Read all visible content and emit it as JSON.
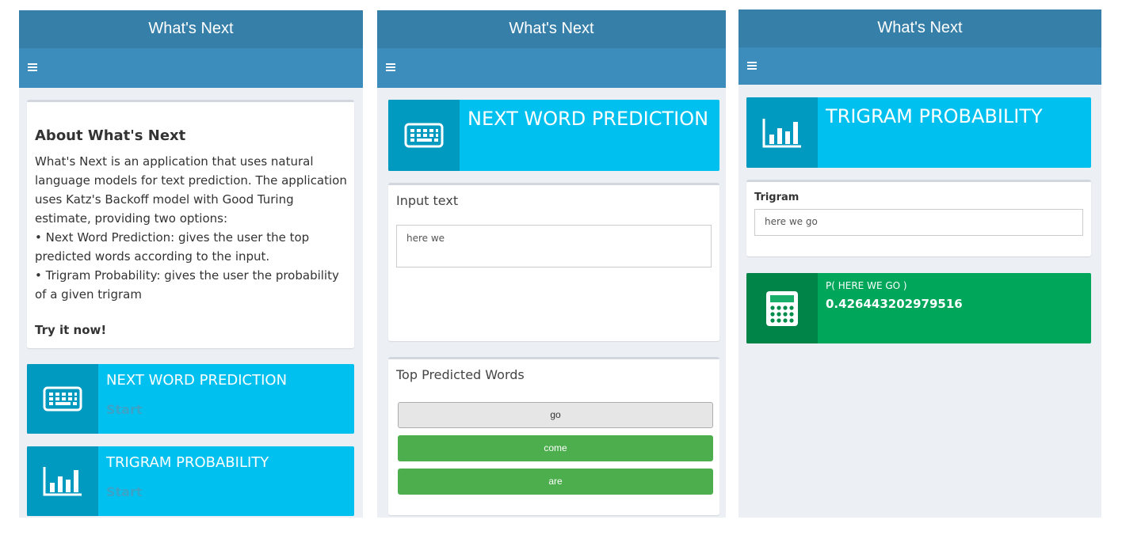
{
  "app_title": "What's Next",
  "menu_icon": "hamburger-icon",
  "panel1": {
    "about_title": "About What's Next",
    "about_lines": [
      "What's Next is an application that uses natural",
      "language models for text prediction. The application",
      "uses Katz's Backoff model with Good Turing",
      "estimate, providing two options:",
      "•  Next Word Prediction: gives the user the top",
      "predicted words according to the input.",
      "•  Trigram Probability: gives the user the probability",
      "of a given trigram"
    ],
    "try_label": "Try it now!",
    "cards": [
      {
        "title": "NEXT WORD PREDICTION",
        "link": "Start",
        "icon": "keyboard-icon"
      },
      {
        "title": "TRIGRAM PROBABILITY",
        "link": "Start",
        "icon": "bar-chart-icon"
      }
    ]
  },
  "panel2": {
    "header": {
      "title": "NEXT WORD PREDICTION",
      "icon": "keyboard-icon"
    },
    "input_box_title": "Input text",
    "input_value": "here we",
    "predicted_title": "Top Predicted Words",
    "predicted_words": [
      "go",
      "come",
      "are"
    ]
  },
  "panel3": {
    "header": {
      "title": "TRIGRAM PROBABILITY",
      "icon": "bar-chart-icon"
    },
    "trigram_label": "Trigram",
    "trigram_value": "here we go",
    "result_label": "P( HERE WE GO )",
    "result_value": "0.426443202979516",
    "result_icon": "calculator-icon"
  },
  "colors": {
    "header": "#367fa9",
    "navbar": "#3c8dbc",
    "aqua": "#00c0ef",
    "green": "#00a65a",
    "button_green": "#4cae4c",
    "background": "#ecf0f5"
  }
}
